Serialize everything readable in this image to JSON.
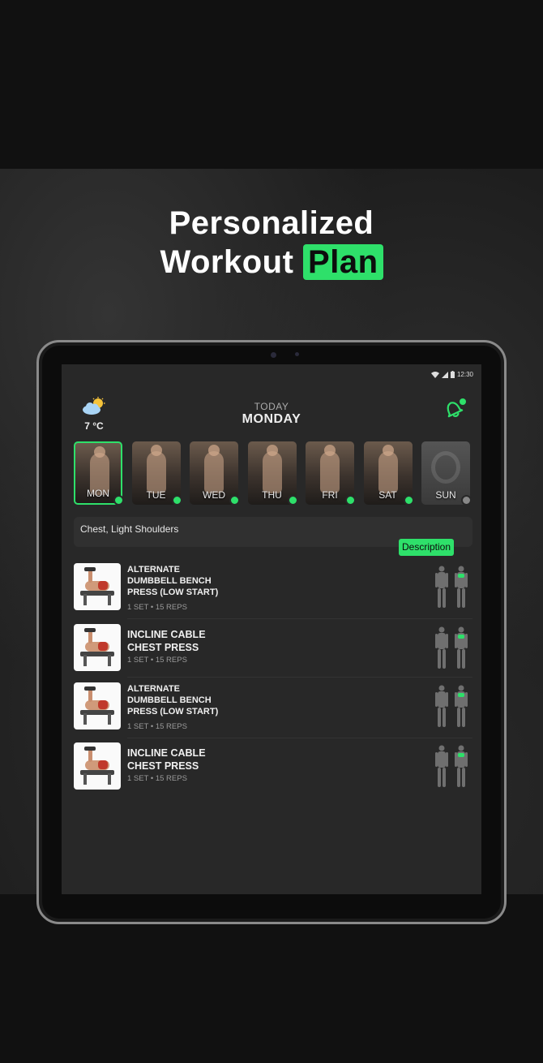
{
  "promo": {
    "headline_line1": "Personalized",
    "headline_line2_part1": "Workout",
    "headline_line2_highlight": "Plan",
    "accent_color": "#2ee06a"
  },
  "status_bar": {
    "time": "12:30"
  },
  "header": {
    "weather_icon": "partly-cloudy-icon",
    "temperature": "7 °C",
    "today_label": "TODAY",
    "day_name": "MONDAY",
    "notification_icon": "bell-icon"
  },
  "days": [
    {
      "label": "MON",
      "completed": true,
      "active": true
    },
    {
      "label": "TUE",
      "completed": true,
      "active": false
    },
    {
      "label": "WED",
      "completed": true,
      "active": false
    },
    {
      "label": "THU",
      "completed": true,
      "active": false
    },
    {
      "label": "FRI",
      "completed": true,
      "active": false
    },
    {
      "label": "SAT",
      "completed": true,
      "active": false
    },
    {
      "label": "SUN",
      "completed": false,
      "active": false
    }
  ],
  "focus": {
    "text": "Chest, Light Shoulders",
    "description_button": "Description"
  },
  "exercises": [
    {
      "title": "ALTERNATE DUMBBELL BENCH PRESS (LOW START)",
      "title_lines": [
        "ALTERNATE",
        "DUMBBELL BENCH",
        "PRESS (LOW START)"
      ],
      "meta": "1 SET • 15 REPS"
    },
    {
      "title": "INCLINE CABLE CHEST PRESS",
      "title_lines": [
        "INCLINE CABLE",
        "CHEST PRESS"
      ],
      "meta": "1 SET • 15 REPS"
    },
    {
      "title": "ALTERNATE DUMBBELL BENCH PRESS (LOW START)",
      "title_lines": [
        "ALTERNATE",
        "DUMBBELL BENCH",
        "PRESS (LOW START)"
      ],
      "meta": "1 SET • 15 REPS"
    },
    {
      "title": "INCLINE CABLE CHEST PRESS",
      "title_lines": [
        "INCLINE CABLE",
        "CHEST PRESS"
      ],
      "meta": "1 SET • 15 REPS"
    }
  ]
}
